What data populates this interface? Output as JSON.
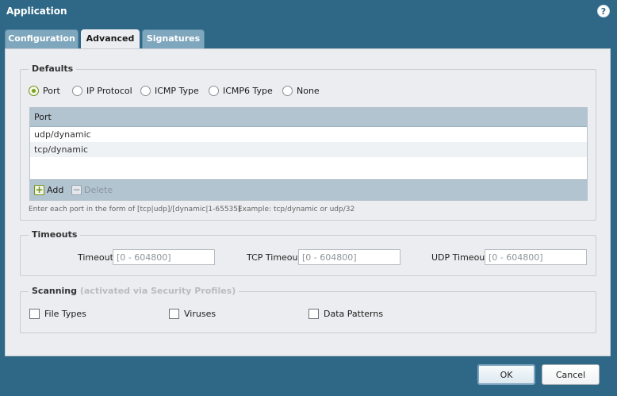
{
  "window": {
    "title": "Application",
    "help_icon": "?"
  },
  "tabs": [
    {
      "label": "Configuration",
      "active": false
    },
    {
      "label": "Advanced",
      "active": true
    },
    {
      "label": "Signatures",
      "active": false
    }
  ],
  "defaults": {
    "legend": "Defaults",
    "options": [
      "Port",
      "IP Protocol",
      "ICMP Type",
      "ICMP6 Type",
      "None"
    ],
    "selected": "Port",
    "grid": {
      "header": "Port",
      "rows": [
        "udp/dynamic",
        "tcp/dynamic"
      ],
      "add_label": "Add",
      "delete_label": "Delete"
    },
    "hint_format": "Enter each port in the form of [tcp|udp]/[dynamic|1-65535]",
    "hint_example": "Example: tcp/dynamic or udp/32"
  },
  "timeouts": {
    "legend": "Timeouts",
    "timeout_label": "Timeout",
    "timeout_placeholder": "[0 - 604800]",
    "tcp_label": "TCP Timeout",
    "tcp_placeholder": "[0 - 604800]",
    "udp_label": "UDP Timeout",
    "udp_placeholder": "[0 - 604800]"
  },
  "scanning": {
    "legend": "Scanning",
    "legend_note": "(activated via Security Profiles)",
    "items": [
      {
        "label": "File Types",
        "checked": false
      },
      {
        "label": "Viruses",
        "checked": false
      },
      {
        "label": "Data Patterns",
        "checked": false
      }
    ]
  },
  "buttons": {
    "ok": "OK",
    "cancel": "Cancel"
  },
  "colors": {
    "titlebar": "#2e6886",
    "panel": "#ecedf0",
    "accent_green": "#7ba026",
    "grid_header": "#b3c4d1"
  }
}
